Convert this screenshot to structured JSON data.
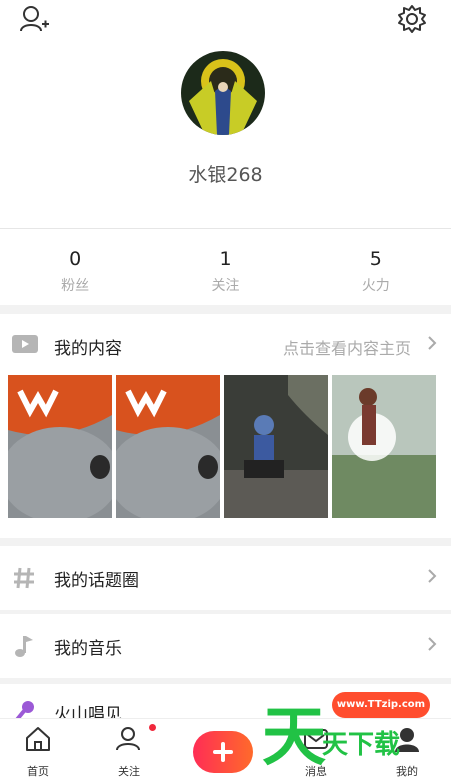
{
  "profile": {
    "username": "水银268"
  },
  "stats": [
    {
      "value": "0",
      "label": "粉丝"
    },
    {
      "value": "1",
      "label": "关注"
    },
    {
      "value": "5",
      "label": "火力"
    }
  ],
  "content": {
    "title": "我的内容",
    "hint": "点击查看内容主页"
  },
  "menu": [
    {
      "label": "我的话题圈",
      "icon": "hashtag-icon"
    },
    {
      "label": "我的音乐",
      "icon": "music-note-icon"
    },
    {
      "label": "火山唱见",
      "icon": "microphone-icon"
    }
  ],
  "nav": {
    "home": "首页",
    "follow": "关注",
    "messages": "消息",
    "mine": "我的"
  },
  "watermark": {
    "site": "www.TTzip.com",
    "text": "天下载",
    "big": "天"
  },
  "colors": {
    "accent": "#ff2d55",
    "watermark_green": "#21c245",
    "badge_red": "#f0283c"
  }
}
